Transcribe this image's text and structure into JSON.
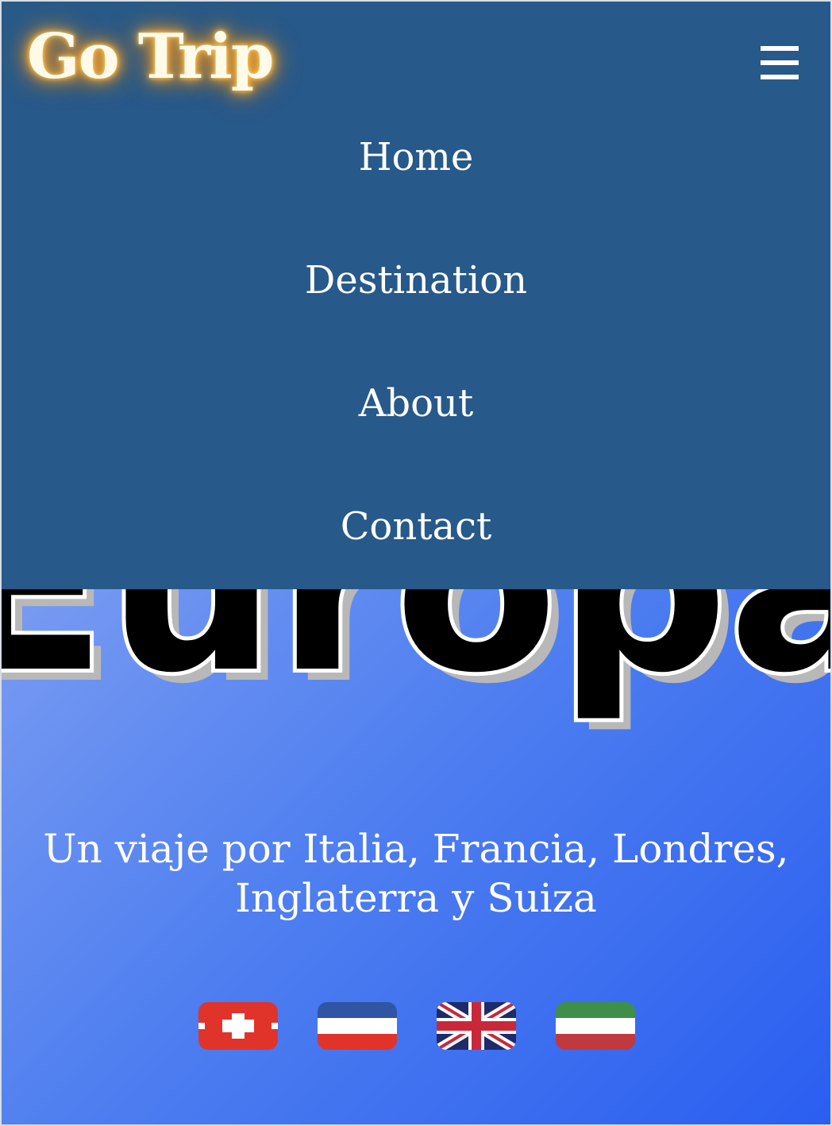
{
  "header": {
    "logo_text": "Go Trip",
    "menu_icon": "hamburger-icon"
  },
  "nav": {
    "items": [
      {
        "label": "Home"
      },
      {
        "label": "Destination"
      },
      {
        "label": "About"
      },
      {
        "label": "Contact"
      }
    ]
  },
  "hero": {
    "title": "Europa",
    "subtitle_line1": "Un viaje por Italia, Francia, Londres,",
    "subtitle_line2": "Inglaterra y Suiza"
  },
  "flags": [
    {
      "name": "switzerland-flag-icon"
    },
    {
      "name": "france-flag-icon"
    },
    {
      "name": "uk-flag-icon"
    },
    {
      "name": "italy-flag-icon"
    }
  ],
  "colors": {
    "nav_background": "#27598a",
    "text": "#ffffff",
    "logo_glow": "#ffb43a"
  }
}
